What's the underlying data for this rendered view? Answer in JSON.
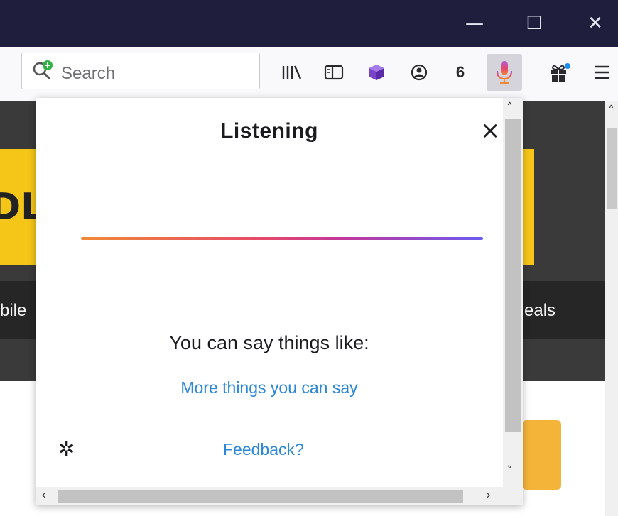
{
  "window": {
    "minimize": "—",
    "maximize": "☐",
    "close": "✕"
  },
  "toolbar": {
    "search_placeholder": "Search",
    "badge_count": "6",
    "icons": [
      "search-add-icon",
      "library-icon",
      "sidebar-icon",
      "extension-cube-icon",
      "account-icon",
      "microphone-icon",
      "gift-icon",
      "menu-icon"
    ]
  },
  "page": {
    "left_fragment": "DL",
    "nav_left": "bile",
    "nav_right": "eals"
  },
  "popup": {
    "title": "Listening",
    "close": "×",
    "prompt": "You can say things like:",
    "more_link": "More things you can say",
    "feedback_link": "Feedback?",
    "settings": "✲"
  },
  "colors": {
    "titlebar": "#1f1f3d",
    "link": "#2b87d8",
    "accent_orange": "#f08a36",
    "accent_purple": "#6a5cf0",
    "page_yellow": "#f5c518"
  }
}
